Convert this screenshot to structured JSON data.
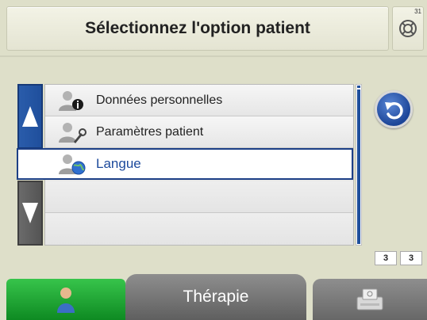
{
  "header": {
    "title": "Sélectionnez l'option patient",
    "corner_number": "31"
  },
  "menu": {
    "items": [
      {
        "label": "Données personnelles",
        "icon": "person-info-icon"
      },
      {
        "label": "Paramètres patient",
        "icon": "person-settings-icon"
      },
      {
        "label": "Langue",
        "icon": "person-globe-icon",
        "selected": true
      }
    ]
  },
  "pagination": {
    "current": "3",
    "total": "3"
  },
  "tabs": {
    "patient": {
      "icon": "person-icon"
    },
    "therapie": {
      "label": "Thérapie"
    },
    "device": {
      "icon": "device-icon"
    }
  },
  "colors": {
    "accent_blue": "#1f4f9c",
    "active_tab_green": "#1aa536",
    "background": "#dedfc9"
  }
}
